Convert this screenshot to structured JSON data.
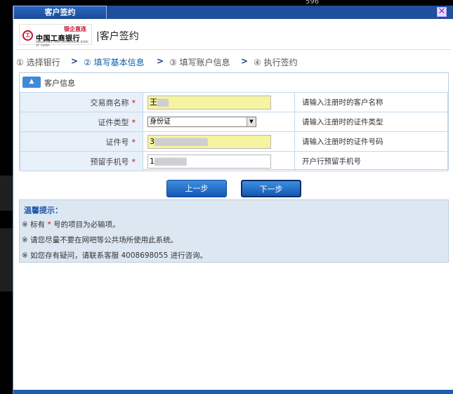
{
  "background": {
    "top_text": "596"
  },
  "window": {
    "title": "客户签约",
    "close_glyph": "✕"
  },
  "header": {
    "logo_small_text": "银企直连",
    "logo_name": "中国工商银行",
    "logo_english": "INDUSTRIAL AND COMMERCIAL BANK OF CHINA",
    "page_title": "|客户签约"
  },
  "steps": {
    "items": [
      {
        "label": "① 选择银行",
        "active": false
      },
      {
        "label": "② 填写基本信息",
        "active": true
      },
      {
        "label": "③ 填写账户信息",
        "active": false
      },
      {
        "label": "④ 执行签约",
        "active": false
      }
    ],
    "separator": ">"
  },
  "panel": {
    "icon": "upload-icon",
    "title": "客户信息",
    "required_mark": "*",
    "rows": [
      {
        "label": "交易商名称",
        "value": "王",
        "hint": "请输入注册时的客户名称"
      },
      {
        "label": "证件类型",
        "value": "身份证",
        "hint": "请输入注册时的证件类型"
      },
      {
        "label": "证件号",
        "value": "3",
        "hint": "请输入注册时的证件号码"
      },
      {
        "label": "预留手机号",
        "value": "1",
        "hint": "开户行预留手机号"
      }
    ]
  },
  "buttons": {
    "prev": "上一步",
    "next": "下一步"
  },
  "tips": {
    "title": "温馨提示：",
    "line1_prefix": "※ 标有 ",
    "line1_mark": "*",
    "line1_suffix": " 号的项目为必输项。",
    "line2": "※ 请您尽量不要在网吧等公共场所使用此系统。",
    "line3": "※ 如您存有疑问，请联系客服 4008698055 进行咨询。"
  },
  "colors": {
    "title_bar": "#1f4f9c",
    "accent_blue": "#1457b3",
    "required_red": "#e00000",
    "field_highlight": "#f6f3a3"
  }
}
